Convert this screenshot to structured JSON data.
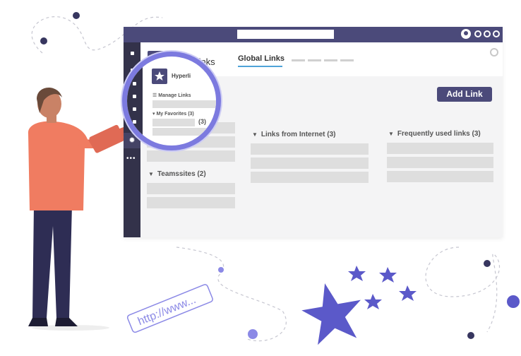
{
  "app": {
    "title": "Hyperlinks",
    "tabs": [
      {
        "label": "Global Links",
        "active": true
      }
    ],
    "add_button_label": "Add Link"
  },
  "sections": [
    {
      "title": "Links from Internet (3)",
      "rows": 3
    },
    {
      "title": "Frequently used links (3)",
      "rows": 3
    },
    {
      "title": "Teamssites (2)",
      "rows": 2
    }
  ],
  "magnifier": {
    "title": "Hyperli",
    "manage_links_label": "Manage Links",
    "my_favorites_label": "My Favorites (3)",
    "partial_count": "(3)"
  },
  "decoration": {
    "url_tag_text": "http://www...",
    "icons": [
      "star-icon",
      "settings-icon",
      "user-icon",
      "bug-icon"
    ]
  },
  "colors": {
    "accent": "#4b4a7a",
    "tab_underline": "#4fa3d8",
    "lens_ring": "#7c7adf",
    "star": "#5b59c9",
    "person_shirt": "#f07c61",
    "person_pants": "#2e2d54"
  }
}
